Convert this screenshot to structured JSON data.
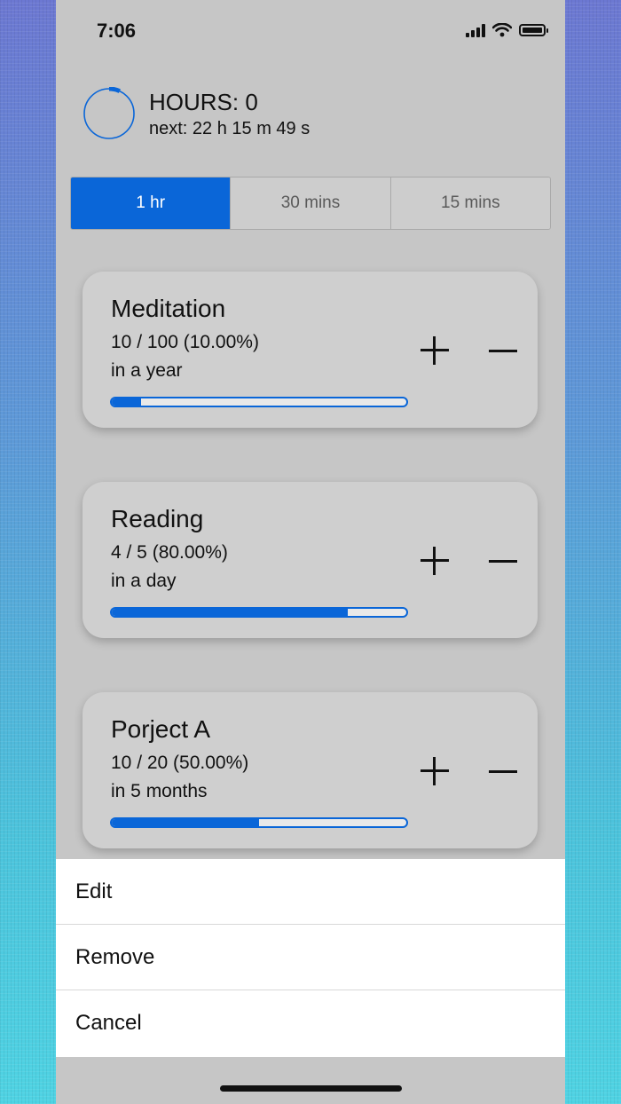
{
  "status_bar": {
    "time": "7:06"
  },
  "summary": {
    "title": "HOURS: 0",
    "next": "next: 22 h 15 m 49 s",
    "ring_progress": 0.07
  },
  "interval_tabs": [
    {
      "label": "1 hr",
      "selected": true
    },
    {
      "label": "30 mins",
      "selected": false
    },
    {
      "label": "15 mins",
      "selected": false
    }
  ],
  "goals": [
    {
      "name": "Meditation",
      "count": "10 / 100 (10.00%)",
      "period": "in a year",
      "progress": 0.1
    },
    {
      "name": "Reading",
      "count": "4 / 5 (80.00%)",
      "period": "in a day",
      "progress": 0.8
    },
    {
      "name": "Porject A",
      "count": "10 / 20 (50.00%)",
      "period": "in 5 months",
      "progress": 0.5
    }
  ],
  "action_sheet": {
    "edit": "Edit",
    "remove": "Remove",
    "cancel": "Cancel"
  },
  "colors": {
    "accent": "#0a66d8",
    "app_background": "#c6c6c6",
    "card_background": "#cfcfcf"
  },
  "icons": {
    "increment": "plus-icon",
    "decrement": "minus-icon",
    "cellular": "cellular-signal-icon",
    "wifi": "wifi-icon",
    "battery": "battery-icon"
  }
}
